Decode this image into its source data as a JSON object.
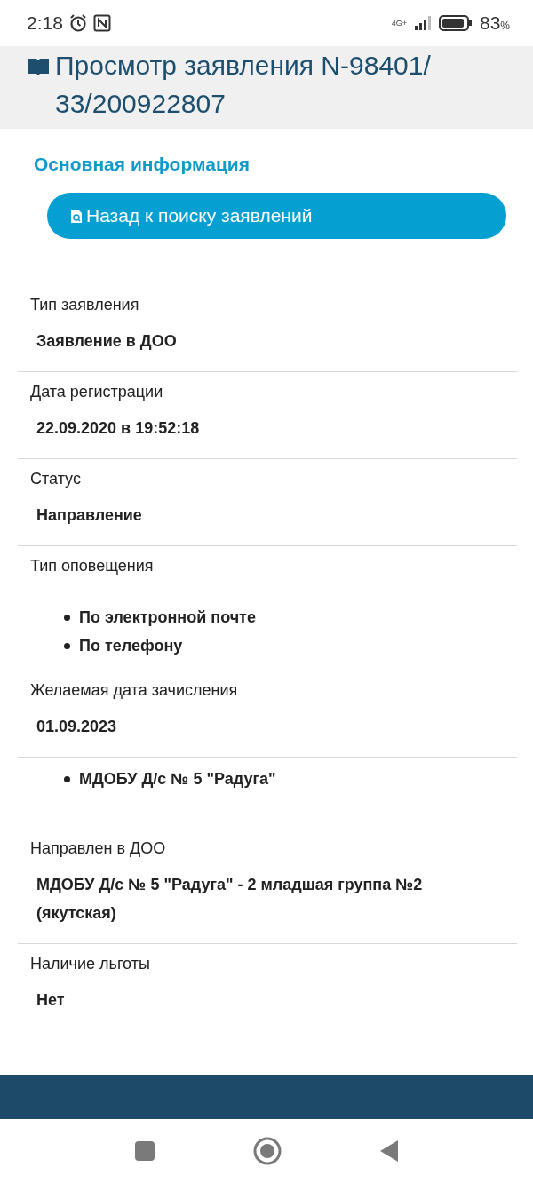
{
  "status_bar": {
    "time": "2:18",
    "network": "4G+",
    "battery": "83",
    "battery_unit": "%"
  },
  "header": {
    "title": "Просмотр заявления N-98401/ 33/200922807"
  },
  "section_title": "Основная информация",
  "back_button": {
    "label": "Назад к поиску заявлений"
  },
  "fields": [
    {
      "kind": "value",
      "label": "Тип заявления",
      "value": "Заявление в ДОО",
      "divider": true
    },
    {
      "kind": "value",
      "label": "Дата регистрации",
      "value": "22.09.2020 в 19:52:18",
      "divider": true
    },
    {
      "kind": "value",
      "label": "Статус",
      "value": "Направление",
      "divider": true
    },
    {
      "kind": "list",
      "label": "Тип оповещения",
      "items": [
        "По электронной почте",
        "По телефону"
      ],
      "divider": false
    },
    {
      "kind": "value",
      "label": "Желаемая дата зачисления",
      "value": "01.09.2023",
      "divider": true
    },
    {
      "kind": "list",
      "items": [
        "МДОБУ Д/с № 5 \"Радуга\""
      ],
      "divider": false
    },
    {
      "kind": "value",
      "label": "Направлен в ДОО",
      "value": "МДОБУ Д/с № 5 \"Радуга\" - 2 младшая группа №2 (якутская)",
      "divider": true
    },
    {
      "kind": "value",
      "label": "Наличие льготы",
      "value": "Нет",
      "divider": false
    }
  ]
}
